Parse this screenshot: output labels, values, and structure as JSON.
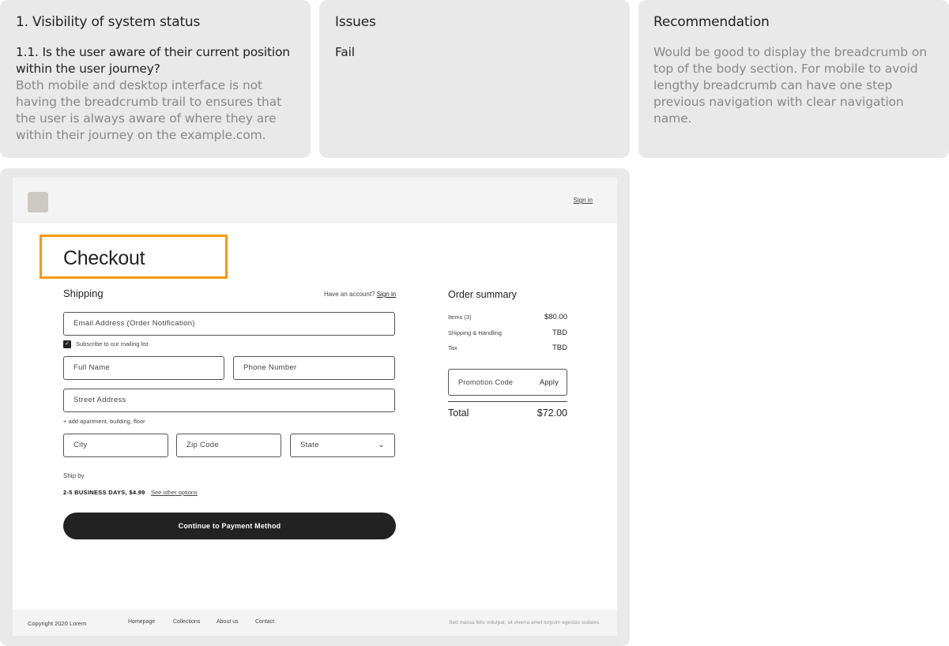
{
  "heuristic_card": {
    "title": "1. Visibility of system status",
    "question": "1.1. Is the user aware of their current position within the user journey?",
    "description": "Both mobile and desktop interface is not having the breadcrumb trail to ensures that the user is always aware of where they are within their journey on the example.com."
  },
  "issues_card": {
    "title": "Issues",
    "result": "Fail"
  },
  "recommendation_card": {
    "title": "Recommendation",
    "text": "Would be good to display the breadcrumb on top of the body section. For mobile to avoid lengthy breadcrumb can have one step previous navigation with clear navigation name."
  },
  "colors": {
    "card_bg": "#e9e9e9",
    "highlight": "#f59a0c",
    "button_bg": "#222222"
  },
  "checkout_page": {
    "header": {
      "sign_in": "Sign in"
    },
    "title": "Checkout",
    "shipping": {
      "label": "Shipping",
      "account_prompt": "Have an account?",
      "account_link": "Sign in",
      "email_placeholder": "Email Address (Order Notification)",
      "subscribe_label": "Subscribe to our mailing list",
      "subscribe_checked": true,
      "full_name_placeholder": "Full Name",
      "phone_placeholder": "Phone Number",
      "street_placeholder": "Street Address",
      "street_hint": "+ add apartment, building, floor",
      "city_placeholder": "City",
      "zip_placeholder": "Zip Code",
      "state_placeholder": "State",
      "ship_by_label": "Ship by",
      "ship_option": "2-5 BUSINESS DAYS, $4.99",
      "see_other_options": "See other options",
      "continue_button": "Continue to Payment Method"
    },
    "order_summary": {
      "title": "Order summary",
      "rows": [
        {
          "label": "Items (3)",
          "value": "$80.00"
        },
        {
          "label": "Shipping & Handling",
          "value": "TBD"
        },
        {
          "label": "Tax",
          "value": "TBD"
        }
      ],
      "promo_placeholder": "Promotion Code",
      "apply_button": "Apply",
      "total_label": "Total",
      "total_value": "$72.00"
    },
    "footer": {
      "copyright": "Copyright 2020 Lorem",
      "links": [
        "Homepage",
        "Collections",
        "About us",
        "Contact"
      ],
      "tagline": "Sed massa felis volutpat, sit viverra amet torpsim egestas sodales."
    }
  }
}
